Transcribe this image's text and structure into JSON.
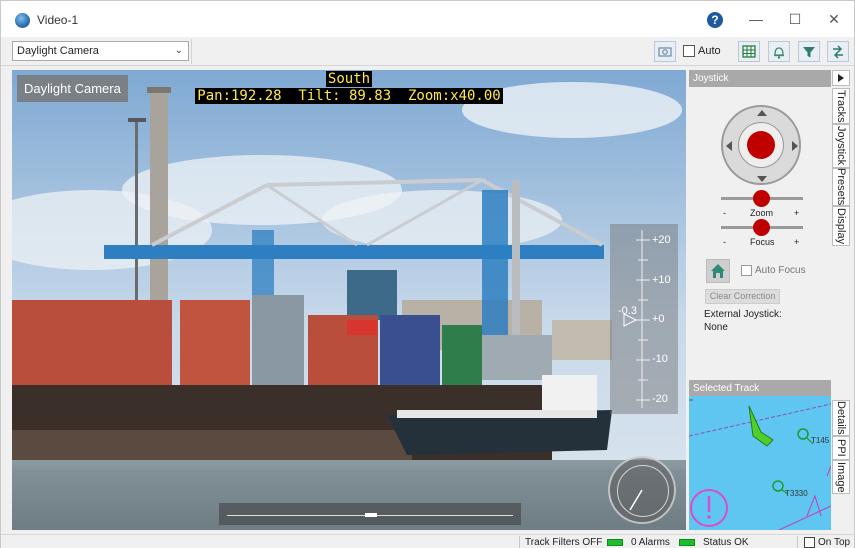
{
  "window": {
    "title": "Video-1"
  },
  "toolbar": {
    "camera_select": "Daylight Camera",
    "auto_label": "Auto",
    "auto_checked": false
  },
  "video": {
    "badge": "Daylight Camera",
    "heading": "South",
    "telemetry": "Pan:192.28  Tilt: 89.83  Zoom:x40.00",
    "ladder_ticks": [
      "+20",
      "+10",
      "+0",
      "-10",
      "-20"
    ],
    "ladder_value": "-0.3"
  },
  "joystick": {
    "panel_title": "Joystick",
    "zoom_label": "Zoom",
    "focus_label": "Focus",
    "minus": "-",
    "plus": "+",
    "auto_focus_label": "Auto Focus",
    "clear_correction_label": "Clear Correction",
    "external_joystick_label": "External Joystick:",
    "external_joystick_value": "None"
  },
  "selected_track": {
    "panel_title": "Selected Track",
    "labels": [
      "T145",
      "T3330"
    ]
  },
  "side_tabs_top": [
    "Tracks",
    "Joystick",
    "Presets",
    "Display"
  ],
  "side_tabs_bottom": [
    "Details",
    "PPI",
    "Image"
  ],
  "status": {
    "track_filters": "Track Filters OFF",
    "alarms": "0 Alarms",
    "status_text": "Status OK",
    "on_top_label": "On Top"
  },
  "colors": {
    "joystick_red": "#c00000",
    "status_green": "#1fbd2e",
    "map_water": "#5ec6f0"
  }
}
